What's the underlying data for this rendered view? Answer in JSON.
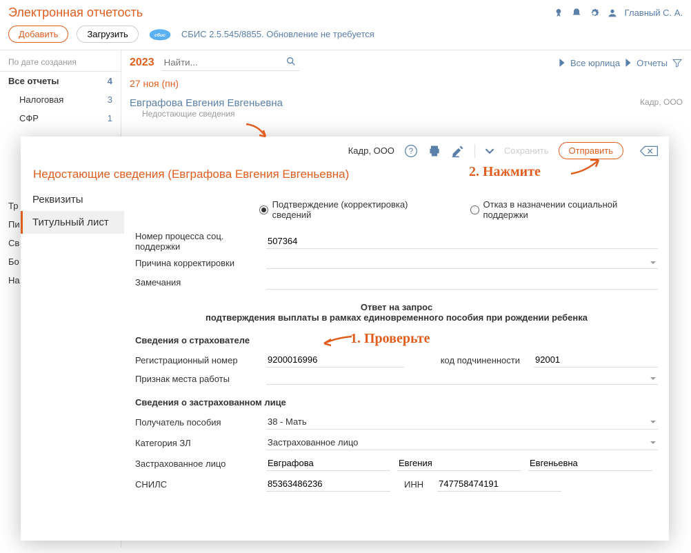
{
  "header": {
    "title": "Электронная отчетость",
    "user": "Главный С. А."
  },
  "toolbar": {
    "add": "Добавить",
    "load": "Загрузить",
    "version": "СБИС 2.5.545/8855. Обновление не требуется"
  },
  "sidebar": {
    "sort": "По дате создания",
    "items": [
      {
        "label": "Все отчеты",
        "count": "4",
        "active": true
      },
      {
        "label": "Налоговая",
        "count": "3",
        "sub": true
      },
      {
        "label": "СФР",
        "count": "1",
        "sub": true
      }
    ],
    "bg_items": [
      "Тр",
      "Пи",
      "Св",
      "Бо",
      "На"
    ]
  },
  "content": {
    "year": "2023",
    "search_placeholder": "Найти...",
    "header_links": [
      "Все юрлица",
      "Отчеты"
    ],
    "date": "27 ноя (пн)",
    "list": {
      "title": "Евграфова Евгения Евгеньевна",
      "org": "Кадр, ООО",
      "sub": "Недостающие сведения"
    }
  },
  "dialog": {
    "org": "Кадр, ООО",
    "save": "Сохранить",
    "send": "Отправить",
    "title": "Недостающие сведения (Евграфова Евгения Евгеньевна)",
    "tabs": [
      "Реквизиты",
      "Титульный лист"
    ],
    "radio1": "Подтверждение (корректировка) сведений",
    "radio2": "Отказ в назначении социальной поддержки",
    "labels": {
      "process": "Номер процесса соц. поддержки",
      "reason": "Причина корректировки",
      "notes": "Замечания",
      "response_title": "Ответ на запрос",
      "response_sub": "подтверждения выплаты в рамках единовременного пособия при рождении ребенка",
      "section1": "Сведения о страхователе",
      "regnum": "Регистрационный номер",
      "subcode": "код подчиненности",
      "workplace": "Признак места работы",
      "section2": "Сведения о застрахованном лице",
      "recipient": "Получатель пособия",
      "category": "Категория ЗЛ",
      "insured": "Застрахованное лицо",
      "snils": "СНИЛС",
      "inn": "ИНН"
    },
    "values": {
      "process": "507364",
      "regnum": "9200016996",
      "subcode": "92001",
      "recipient": "38 - Мать",
      "category": "Застрахованное лицо",
      "lastname": "Евграфова",
      "firstname": "Евгения",
      "patronymic": "Евгеньевна",
      "snils": "85363486236",
      "inn": "747758474191"
    }
  },
  "annotations": {
    "step1": "1. Проверьте",
    "step2": "2. Нажмите"
  }
}
